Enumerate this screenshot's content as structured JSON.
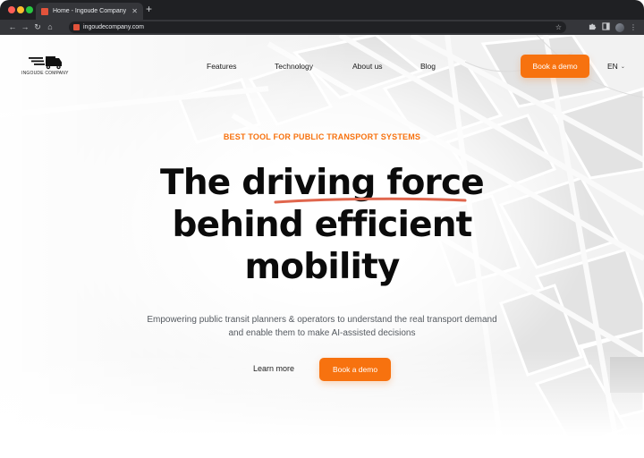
{
  "browser": {
    "tab_title": "Home - Ingoude Company",
    "tab_close": "✕",
    "new_tab": "+",
    "url": "ingoudecompany.com",
    "star_icon": "☆"
  },
  "header": {
    "logo_text": "INGOUDE COMPANY",
    "nav": [
      "Features",
      "Technology",
      "About us",
      "Blog"
    ],
    "cta": "Book a demo",
    "language": "EN"
  },
  "hero": {
    "eyebrow": "BEST TOOL FOR PUBLIC TRANSPORT SYSTEMS",
    "headline_lines": [
      "The driving force",
      "behind efficient",
      "mobility"
    ],
    "subtitle": "Empowering public transit planners & operators to understand the real transport demand and enable them to make AI-assisted decisions",
    "secondary_cta": "Learn more",
    "primary_cta": "Book a demo"
  },
  "colors": {
    "accent": "#f7720f",
    "underline": "#e0664d",
    "chrome_dark": "#1f2023",
    "chrome_toolbar": "#35363a"
  },
  "icons": {
    "back": "back-arrow-icon",
    "forward": "forward-arrow-icon",
    "reload": "reload-icon",
    "home": "home-icon",
    "extensions": "puzzle-icon",
    "sidebar": "sidebar-icon",
    "menu": "kebab-menu-icon"
  }
}
